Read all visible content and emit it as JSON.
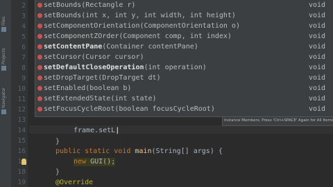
{
  "side_tabs": [
    "Files",
    "Projects",
    "Navigator"
  ],
  "gutter": {
    "line_numbers": [
      "2",
      "3",
      "4",
      "5",
      "6",
      "7",
      "8",
      "9",
      "10",
      "11",
      "12",
      "13",
      "14",
      "15",
      "16",
      "17",
      "18",
      "19"
    ]
  },
  "completion": {
    "items": [
      {
        "name": "setBounds",
        "params": "(Rectangle r)",
        "ret": "void"
      },
      {
        "name": "setBounds",
        "params": "(int x, int y, int width, int height)",
        "ret": "void"
      },
      {
        "name": "setComponentOrientation",
        "params": "(ComponentOrientation o)",
        "ret": "void"
      },
      {
        "name": "setComponentZOrder",
        "params": "(Component comp, int index)",
        "ret": "void"
      },
      {
        "name": "setContentPane",
        "params": "(Container contentPane)",
        "ret": "void"
      },
      {
        "name": "setCursor",
        "params": "(Cursor cursor)",
        "ret": "void"
      },
      {
        "name": "setDefaultCloseOperation",
        "params": "(int operation)",
        "ret": "void"
      },
      {
        "name": "setDropTarget",
        "params": "(DropTarget dt)",
        "ret": "void"
      },
      {
        "name": "setEnabled",
        "params": "(boolean b)",
        "ret": "void"
      },
      {
        "name": "setExtendedState",
        "params": "(int state)",
        "ret": "void"
      },
      {
        "name": "setFocusCycleRoot",
        "params": "(boolean focusCycleRoot)",
        "ret": "void"
      }
    ],
    "hint": "Instance Members; Press 'Ctrl+SPACE' Again for All Items"
  },
  "code": {
    "line14": "frame.setL",
    "line15": "}",
    "line16_kw": "public static void ",
    "line16_fn": "main",
    "line16_rest": "(String[] args) {",
    "line17_kw": "new ",
    "line17_rest": "GUI();",
    "line18": "}",
    "line19": "@Override"
  }
}
